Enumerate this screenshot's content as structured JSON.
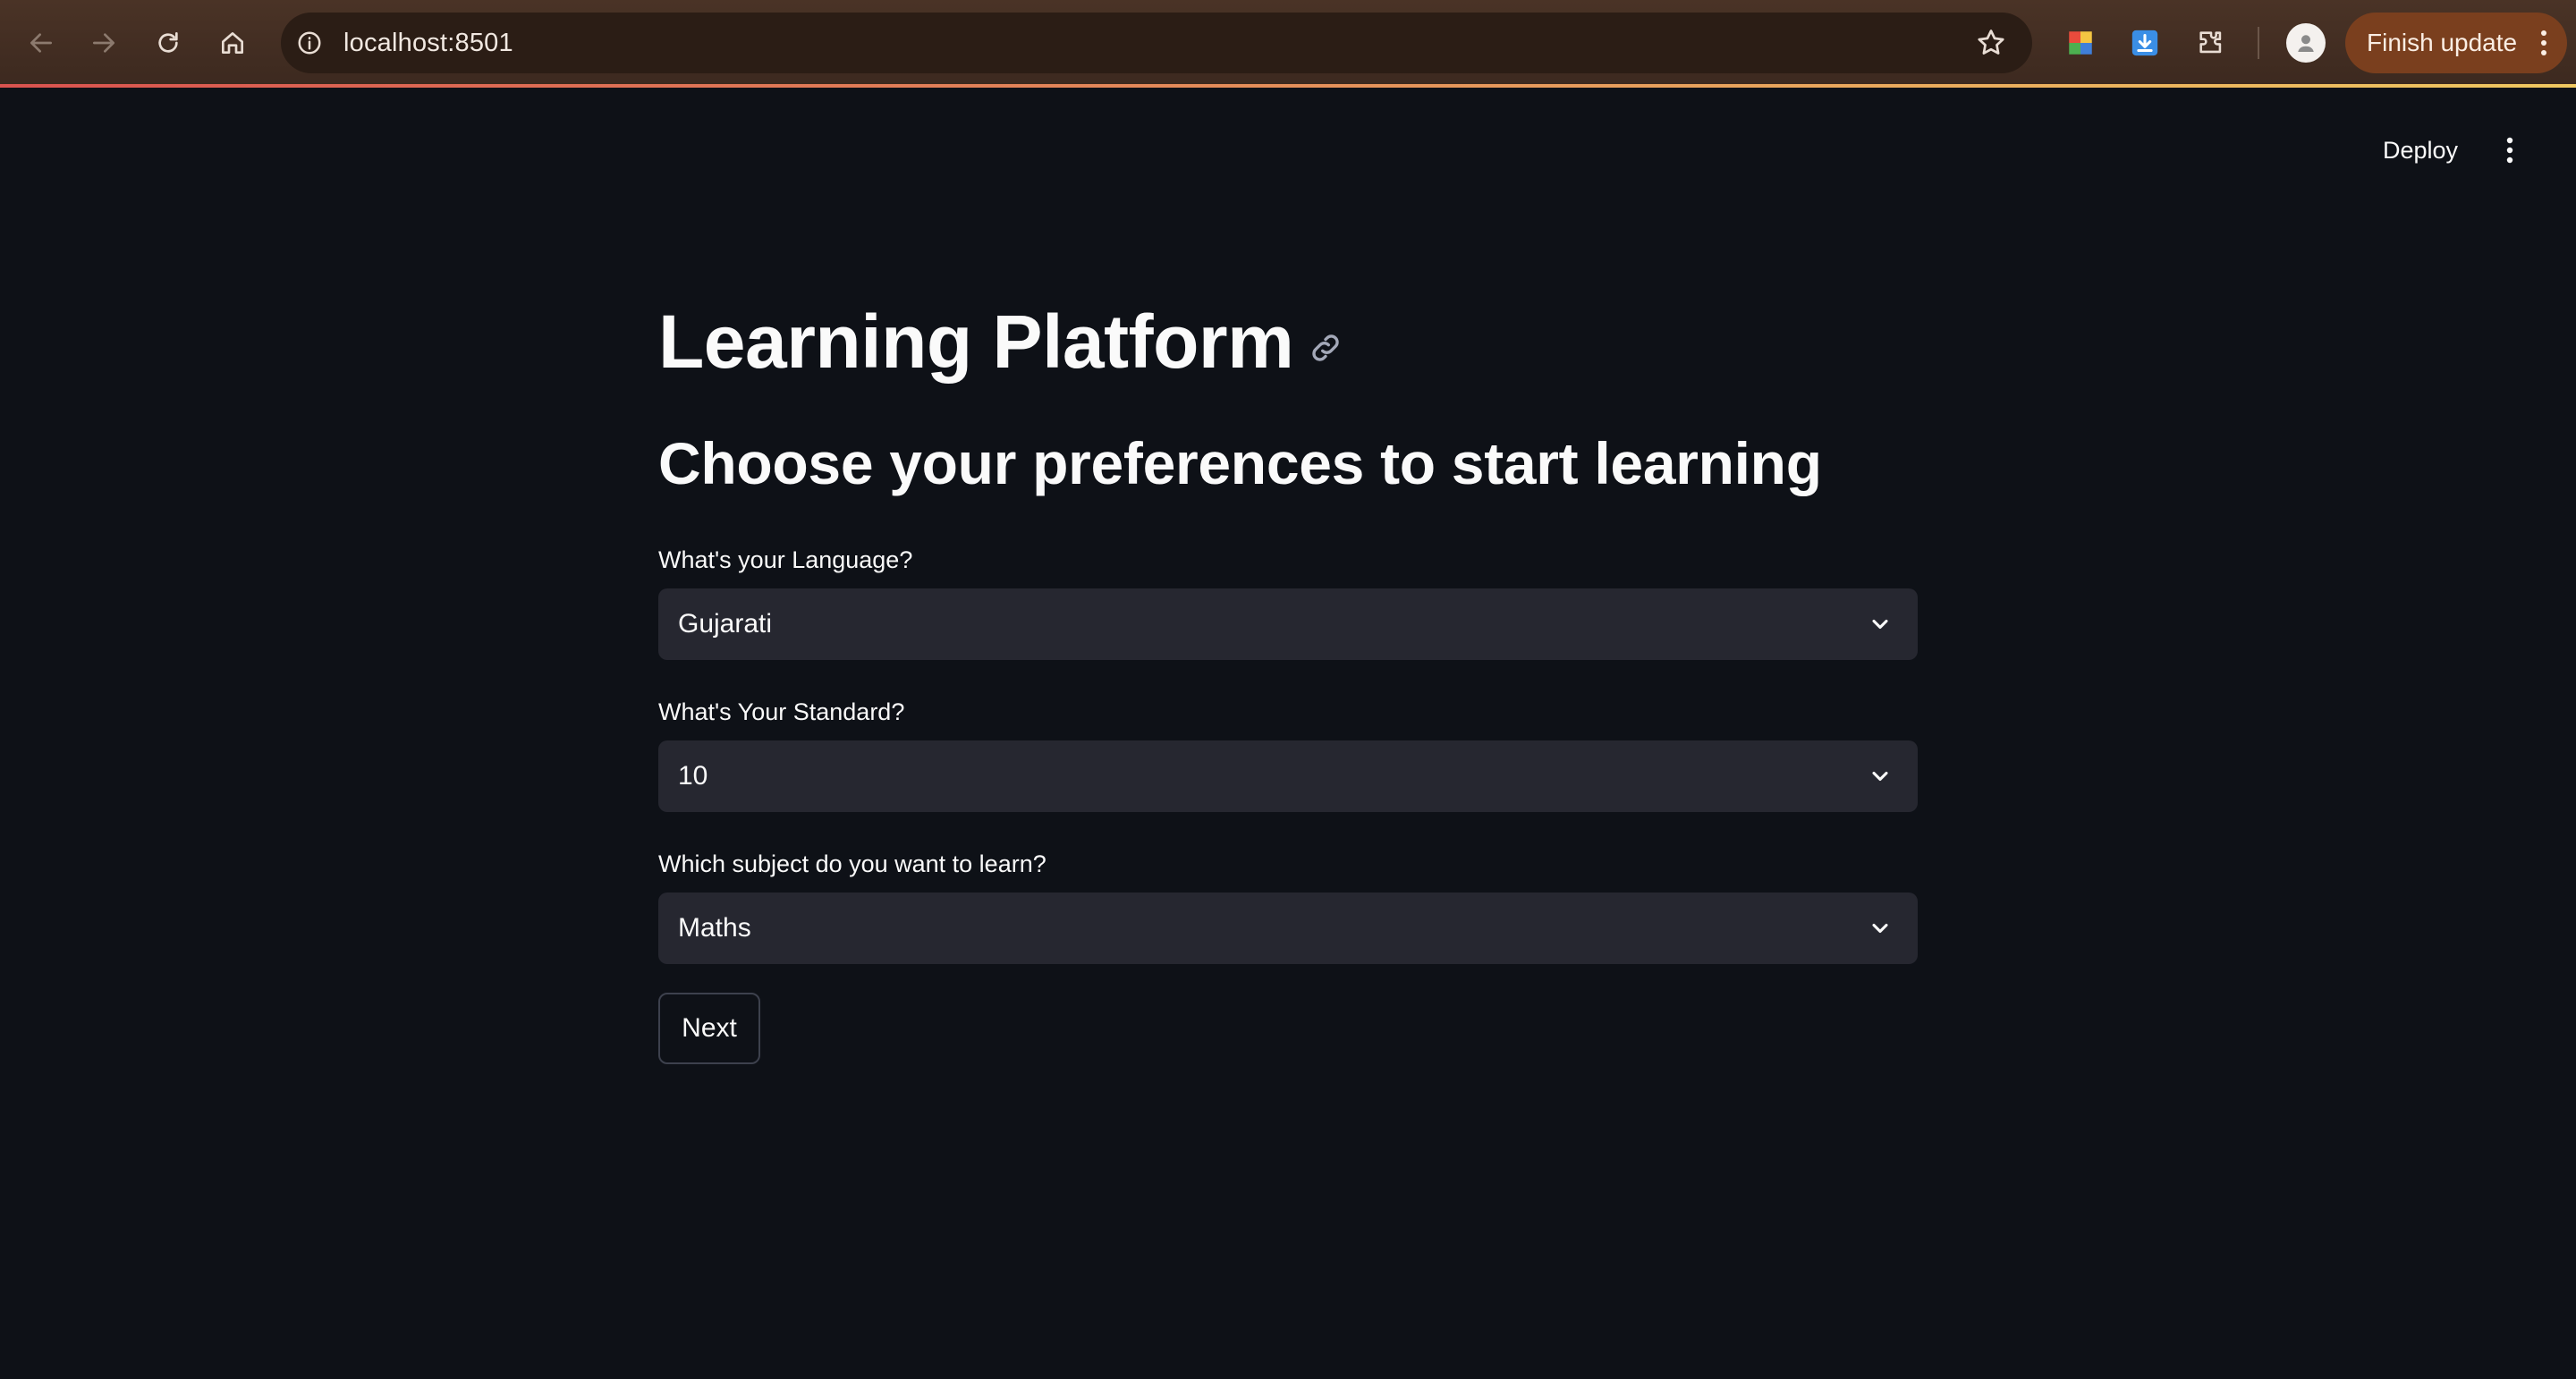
{
  "browser": {
    "url": "localhost:8501",
    "finish_update_label": "Finish update"
  },
  "app_header": {
    "deploy_label": "Deploy"
  },
  "main": {
    "title": "Learning Platform",
    "subtitle": "Choose your preferences to start learning",
    "fields": [
      {
        "label": "What's your Language?",
        "value": "Gujarati"
      },
      {
        "label": "What's Your Standard?",
        "value": "10"
      },
      {
        "label": "Which subject do you want to learn?",
        "value": "Maths"
      }
    ],
    "next_label": "Next"
  },
  "colors": {
    "background": "#0e1117",
    "select_bg": "#262730",
    "chrome_bg": "#3c291f",
    "finish_update_bg": "#7a3f1e"
  }
}
